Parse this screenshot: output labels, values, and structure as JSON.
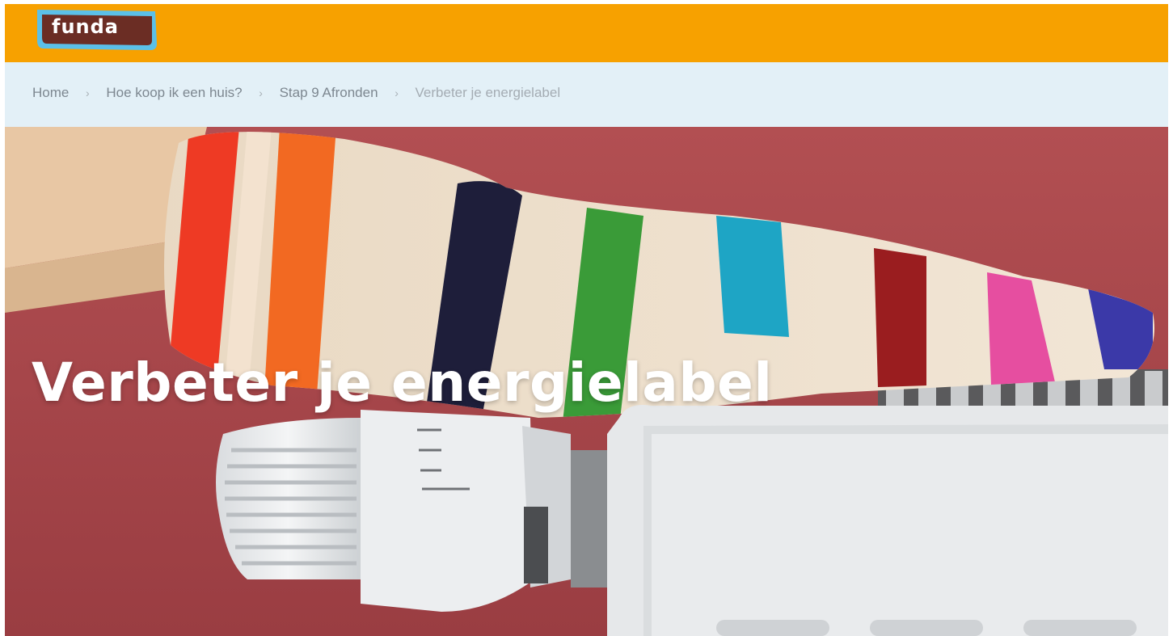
{
  "header": {
    "logo_text": "funda",
    "brand_color": "#f7a100",
    "logo_bg_color": "#6b2d24",
    "logo_outline_color": "#5bc0e8"
  },
  "breadcrumb": {
    "items": [
      {
        "label": "Home"
      },
      {
        "label": "Hoe koop ik een huis?"
      },
      {
        "label": "Stap 9 Afronden"
      },
      {
        "label": "Verbeter je energielabel"
      }
    ],
    "separator": "›"
  },
  "hero": {
    "title": "Verbeter je energielabel",
    "image_description_icon": "mitten-on-radiator-image"
  }
}
